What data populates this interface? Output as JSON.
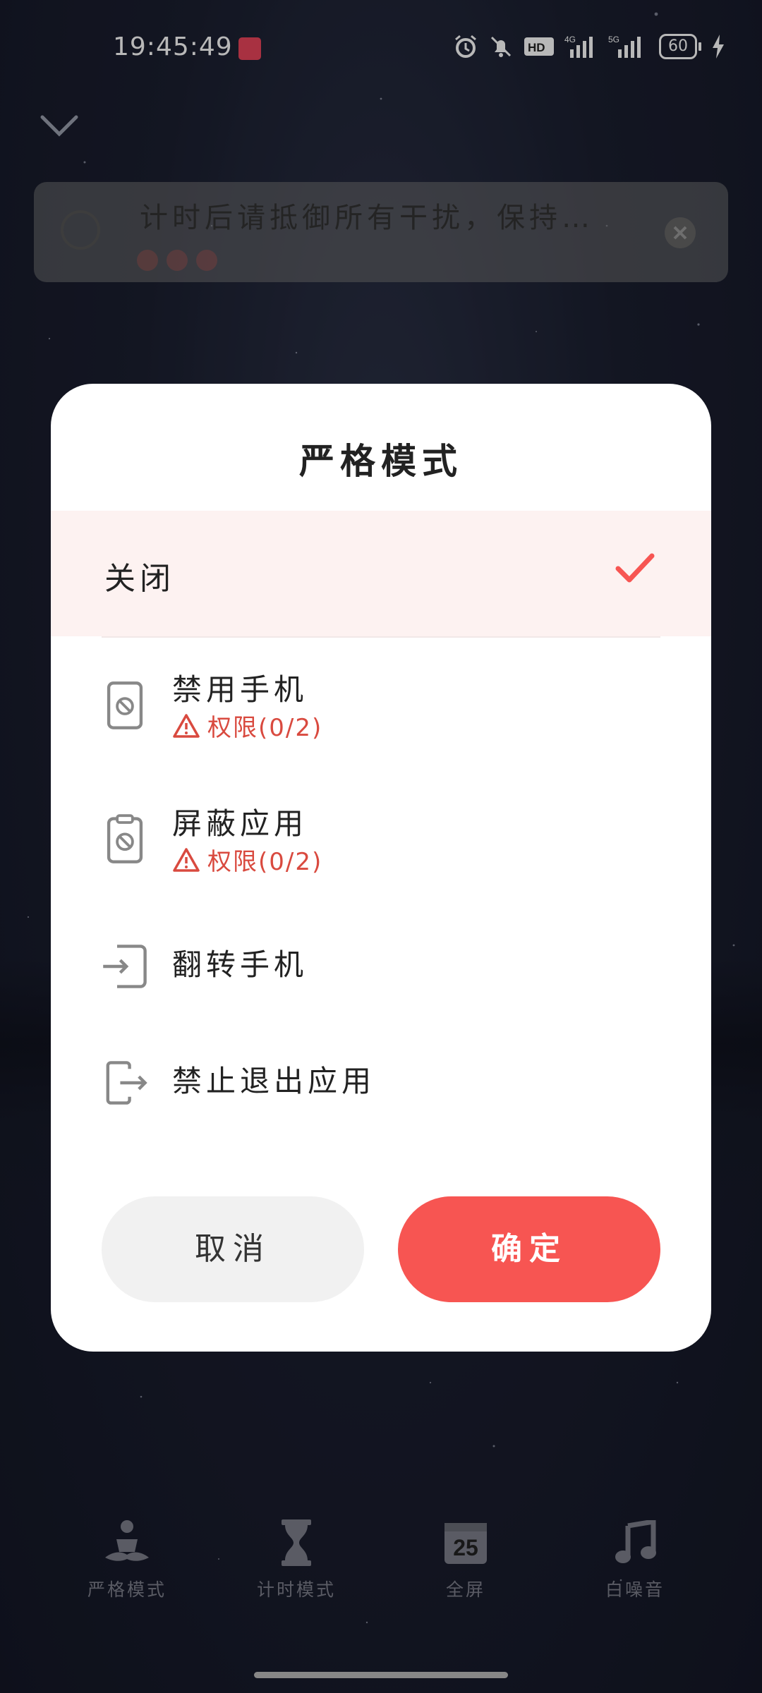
{
  "status_bar": {
    "time": "19:45:49",
    "battery": "60"
  },
  "task": {
    "text": "计时后请抵御所有干扰，保持…"
  },
  "dialog": {
    "title": "严格模式",
    "options": [
      {
        "label": "关闭",
        "selected": true
      },
      {
        "label": "禁用手机",
        "permission": "权限(0/2)"
      },
      {
        "label": "屏蔽应用",
        "permission": "权限(0/2)"
      },
      {
        "label": "翻转手机"
      },
      {
        "label": "禁止退出应用"
      }
    ],
    "cancel_label": "取消",
    "confirm_label": "确定"
  },
  "bottom_nav": [
    {
      "label": "严格模式",
      "icon": "meditation-icon"
    },
    {
      "label": "计时模式",
      "icon": "hourglass-icon"
    },
    {
      "label": "全屏",
      "icon": "calendar-25-icon",
      "badge": "25"
    },
    {
      "label": "白噪音",
      "icon": "music-note-icon"
    }
  ],
  "colors": {
    "accent": "#f75552",
    "selected_row_bg": "#fdf2f1",
    "warning": "#d94a3f",
    "cancel_bg": "#f1f1f1"
  }
}
